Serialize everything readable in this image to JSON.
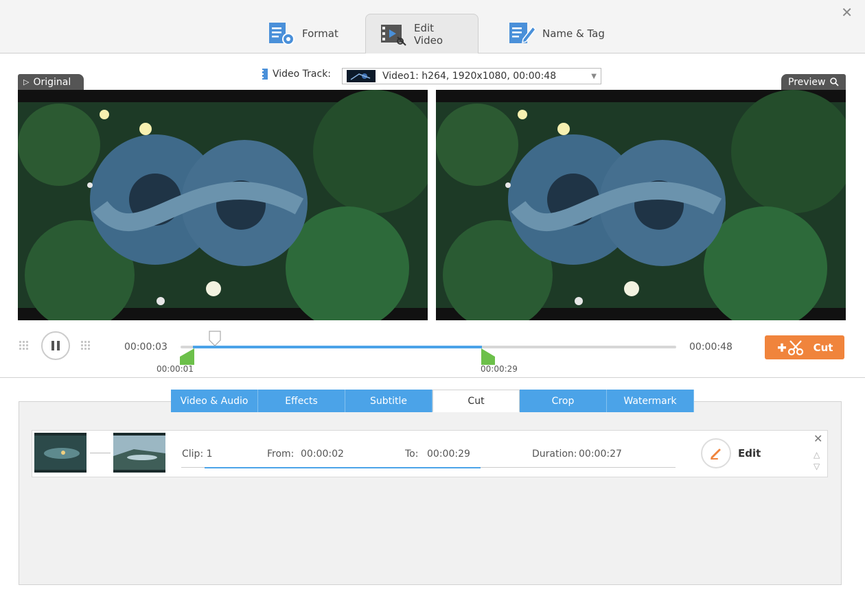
{
  "window": {
    "close_icon": "close-icon"
  },
  "tabs": [
    {
      "label": "Format",
      "icon": "format-icon",
      "active": false
    },
    {
      "label": "Edit Video",
      "icon": "edit-video-icon",
      "active": true
    },
    {
      "label": "Name & Tag",
      "icon": "name-tag-icon",
      "active": false
    }
  ],
  "preview": {
    "original_label": "Original",
    "preview_label": "Preview",
    "video_track_label": "Video Track:",
    "video_track_value": "Video1: h264, 1920x1080, 00:00:48"
  },
  "player": {
    "current_time": "00:00:03",
    "total_time": "00:00:48",
    "start_marker": "00:00:01",
    "end_marker": "00:00:29",
    "cut_label": "Cut",
    "colors": {
      "accent": "#4ba3e8",
      "cut": "#f0843c",
      "marker": "#6cc04a"
    }
  },
  "edit_tabs": [
    {
      "label": "Video & Audio",
      "active": false
    },
    {
      "label": "Effects",
      "active": false
    },
    {
      "label": "Subtitle",
      "active": false
    },
    {
      "label": "Cut",
      "active": true
    },
    {
      "label": "Crop",
      "active": false
    },
    {
      "label": "Watermark",
      "active": false
    }
  ],
  "clip": {
    "clip_label": "Clip: 1",
    "from_label": "From:",
    "from_value": "00:00:02",
    "to_label": "To:",
    "to_value": "00:00:29",
    "duration_label": "Duration:",
    "duration_value": "00:00:27",
    "edit_label": "Edit"
  }
}
